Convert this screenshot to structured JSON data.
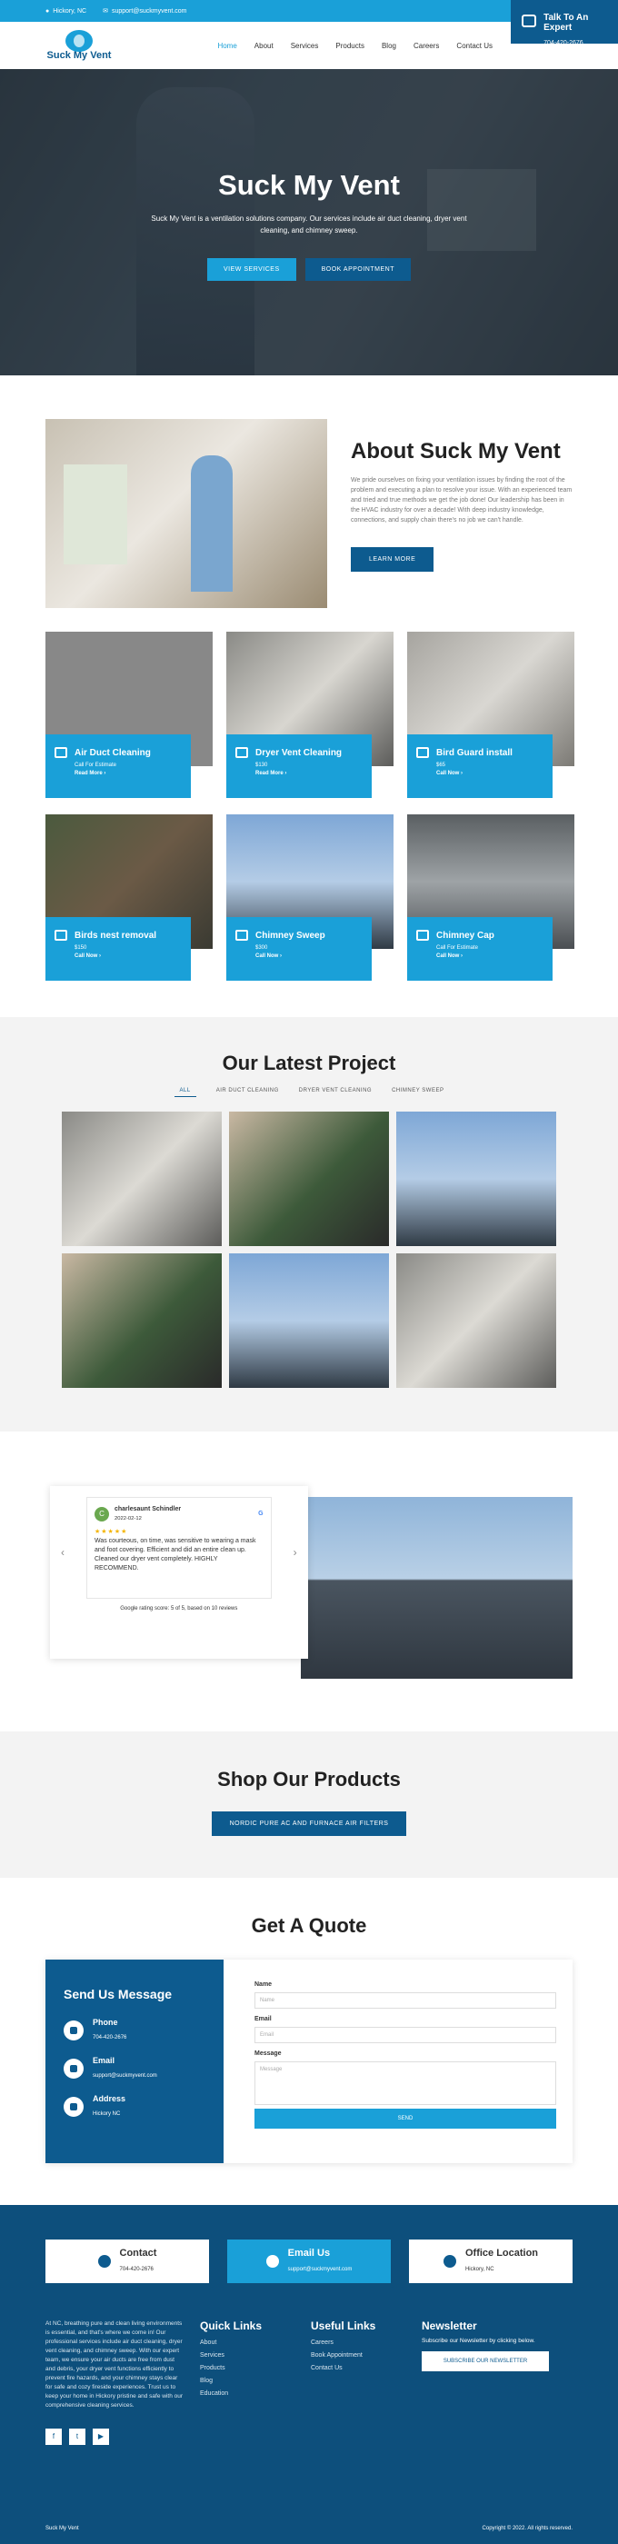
{
  "topbar": {
    "location": "Hickory, NC",
    "email": "support@suckmyvent.com",
    "social": [
      "f",
      "t",
      "▶"
    ]
  },
  "header": {
    "logo_text": "Suck My Vent",
    "nav": [
      "Home",
      "About",
      "Services",
      "Products",
      "Blog",
      "Careers",
      "Contact Us"
    ],
    "talk_title": "Talk To An Expert",
    "talk_phone": "704-420-2676"
  },
  "hero": {
    "title": "Suck My Vent",
    "subtitle": "Suck My Vent is a ventilation solutions company. Our services include air duct cleaning, dryer vent cleaning, and chimney sweep.",
    "btn_services": "VIEW SERVICES",
    "btn_book": "BOOK APPOINTMENT"
  },
  "about": {
    "title": "About Suck My Vent",
    "body": "We pride ourselves on fixing your ventilation issues by finding the root of the problem and executing a plan to resolve your issue. With an experienced team and tried and true methods we get the job done! Our leadership has been in the HVAC industry for over a decade! With deep industry knowledge, connections, and supply chain there's no job we can't handle.",
    "button": "LEARN MORE"
  },
  "services": [
    {
      "name": "Air Duct Cleaning",
      "price": "Call For Estimate",
      "link": "Read More"
    },
    {
      "name": "Dryer Vent Cleaning",
      "price": "$130",
      "link": "Read More"
    },
    {
      "name": "Bird Guard install",
      "price": "$65",
      "link": "Call Now"
    },
    {
      "name": "Birds nest removal",
      "price": "$150",
      "link": "Call Now"
    },
    {
      "name": "Chimney Sweep",
      "price": "$300",
      "link": "Call Now"
    },
    {
      "name": "Chimney Cap",
      "price": "Call For Estimate",
      "link": "Call Now"
    }
  ],
  "projects": {
    "title": "Our Latest Project",
    "filters": [
      "ALL",
      "AIR DUCT CLEANING",
      "DRYER VENT CLEANING",
      "CHIMNEY SWEEP"
    ]
  },
  "review": {
    "name": "charlesaunt Schindler",
    "date": "2022-02-12",
    "stars": "★★★★★",
    "text": "Was courteous, on time, was sensitive to wearing a mask and foot covering. Efficient and did an entire clean up. Cleaned our dryer vent completely. HIGHLY RECOMMEND.",
    "summary": "Google rating score: 5 of 5, based on 10 reviews"
  },
  "shop": {
    "title": "Shop Our Products",
    "button": "NORDIC PURE AC AND FURNACE AIR FILTERS"
  },
  "quote": {
    "title": "Get A Quote",
    "side_title": "Send Us Message",
    "phone_label": "Phone",
    "phone": "704-420-2676",
    "email_label": "Email",
    "email": "support@suckmyvent.com",
    "address_label": "Address",
    "address": "Hickory NC",
    "name_label": "Name",
    "name_ph": "Name",
    "email_field_label": "Email",
    "email_ph": "Email",
    "message_label": "Message",
    "message_ph": "Message",
    "send": "SEND"
  },
  "footer": {
    "contact_title": "Contact",
    "contact_value": "704-420-2676",
    "email_title": "Email Us",
    "email_value": "support@suckmyvent.com",
    "office_title": "Office Location",
    "office_value": "Hickory, NC",
    "about": "At NC, breathing pure and clean living environments is essential, and that's where we come in! Our professional services include air duct cleaning, dryer vent cleaning, and chimney sweep. With our expert team, we ensure your air ducts are free from dust and debris, your dryer vent functions efficiently to prevent fire hazards, and your chimney stays clear for safe and cozy fireside experiences. Trust us to keep your home in Hickory pristine and safe with our comprehensive cleaning services.",
    "quick_title": "Quick Links",
    "quick": [
      "About",
      "Services",
      "Products",
      "Blog",
      "Education"
    ],
    "useful_title": "Useful Links",
    "useful": [
      "Careers",
      "Book Appointment",
      "Contact Us"
    ],
    "news_title": "Newsletter",
    "news_text": "Subscribe our Newsletter by clicking below.",
    "news_button": "SUBSCRIBE OUR NEWSLETTER",
    "brand": "Suck My Vent",
    "copyright": "Copyright © 2022. All rights reserved."
  },
  "colors": {
    "primary": "#1aa0d8",
    "dark": "#0d5b8f"
  }
}
